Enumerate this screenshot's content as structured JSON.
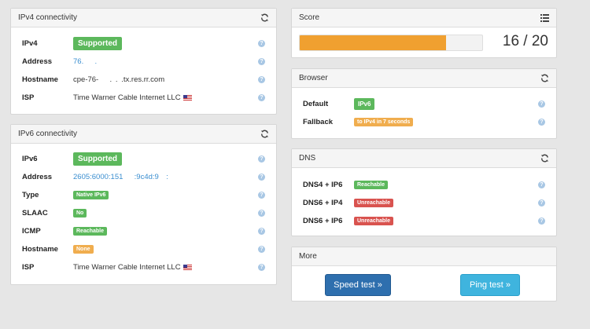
{
  "ipv4": {
    "title": "IPv4 connectivity",
    "rows": [
      {
        "label": "IPv4",
        "value": "Supported"
      },
      {
        "label": "Address",
        "value": "76.   .  "
      },
      {
        "label": "Hostname",
        "value": "cpe-76-   . . .tx.res.rr.com"
      },
      {
        "label": "ISP",
        "value": "Time Warner Cable Internet LLC"
      }
    ]
  },
  "ipv6": {
    "title": "IPv6 connectivity",
    "rows": [
      {
        "label": "IPv6",
        "value": "Supported"
      },
      {
        "label": "Address",
        "value": "2605:6000:151   :9c4d:9  :   "
      },
      {
        "label": "Type",
        "value": "Native IPv6"
      },
      {
        "label": "SLAAC",
        "value": "No"
      },
      {
        "label": "ICMP",
        "value": "Reachable"
      },
      {
        "label": "Hostname",
        "value": "None"
      },
      {
        "label": "ISP",
        "value": "Time Warner Cable Internet LLC"
      }
    ]
  },
  "score": {
    "title": "Score",
    "text": "16 / 20",
    "fraction": 0.8
  },
  "browser": {
    "title": "Browser",
    "rows": [
      {
        "label": "Default",
        "value": "IPv6"
      },
      {
        "label": "Fallback",
        "value": "to IPv4 in 7 seconds"
      }
    ]
  },
  "dns": {
    "title": "DNS",
    "rows": [
      {
        "label": "DNS4 + IP6",
        "value": "Reachable"
      },
      {
        "label": "DNS6 + IP4",
        "value": "Unreachable"
      },
      {
        "label": "DNS6 + IP6",
        "value": "Unreachable"
      }
    ]
  },
  "more": {
    "title": "More",
    "speed_test": "Speed test »",
    "ping_test": "Ping test »"
  },
  "help_glyph": "?",
  "colors": {
    "success": "#5cb85c",
    "danger": "#d9534f",
    "warning": "#f0ad4e",
    "progress": "#f0a030",
    "primary": "#2e6fae",
    "info": "#3fb4de"
  },
  "icons": {
    "refresh": "refresh-icon",
    "list": "list-icon",
    "help": "help-icon",
    "flag": "us-flag-icon"
  }
}
